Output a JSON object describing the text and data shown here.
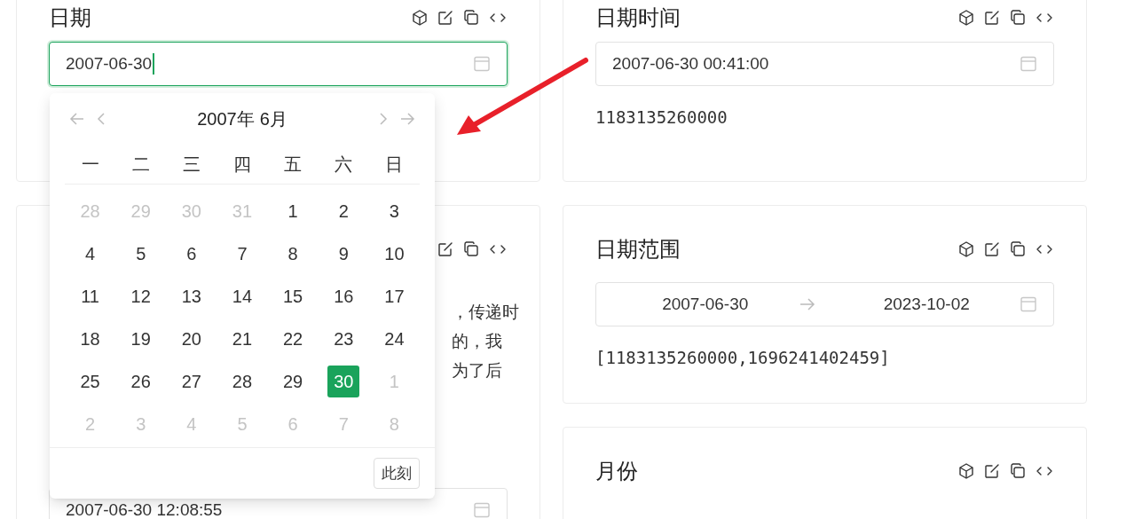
{
  "left_column": [
    {
      "kind": "single",
      "title": "日期",
      "field": {
        "value": "2007-06-30",
        "focused": true
      }
    },
    {
      "kind": "covered",
      "paragraph_lines": [
        "，传递时",
        "的，我",
        "为了后"
      ],
      "field": {
        "value": "2007-06-30 12:08:55",
        "focused": false
      }
    }
  ],
  "right_column": [
    {
      "kind": "single",
      "title": "日期时间",
      "field": {
        "value": "2007-06-30 00:41:00",
        "focused": false
      },
      "output": "1183135260000"
    },
    {
      "kind": "range",
      "title": "日期范围",
      "range": {
        "start": "2007-06-30",
        "end": "2023-10-02"
      },
      "output": "[1183135260000,1696241402459]"
    },
    {
      "kind": "single",
      "title": "月份"
    }
  ],
  "date_picker": {
    "year": "2007年",
    "month": "6月",
    "weekdays": [
      "一",
      "二",
      "三",
      "四",
      "五",
      "六",
      "日"
    ],
    "weeks": [
      [
        {
          "day": "28",
          "in_month": false,
          "selected": false
        },
        {
          "day": "29",
          "in_month": false,
          "selected": false
        },
        {
          "day": "30",
          "in_month": false,
          "selected": false
        },
        {
          "day": "31",
          "in_month": false,
          "selected": false
        },
        {
          "day": "1",
          "in_month": true,
          "selected": false
        },
        {
          "day": "2",
          "in_month": true,
          "selected": false
        },
        {
          "day": "3",
          "in_month": true,
          "selected": false
        }
      ],
      [
        {
          "day": "4",
          "in_month": true,
          "selected": false
        },
        {
          "day": "5",
          "in_month": true,
          "selected": false
        },
        {
          "day": "6",
          "in_month": true,
          "selected": false
        },
        {
          "day": "7",
          "in_month": true,
          "selected": false
        },
        {
          "day": "8",
          "in_month": true,
          "selected": false
        },
        {
          "day": "9",
          "in_month": true,
          "selected": false
        },
        {
          "day": "10",
          "in_month": true,
          "selected": false
        }
      ],
      [
        {
          "day": "11",
          "in_month": true,
          "selected": false
        },
        {
          "day": "12",
          "in_month": true,
          "selected": false
        },
        {
          "day": "13",
          "in_month": true,
          "selected": false
        },
        {
          "day": "14",
          "in_month": true,
          "selected": false
        },
        {
          "day": "15",
          "in_month": true,
          "selected": false
        },
        {
          "day": "16",
          "in_month": true,
          "selected": false
        },
        {
          "day": "17",
          "in_month": true,
          "selected": false
        }
      ],
      [
        {
          "day": "18",
          "in_month": true,
          "selected": false
        },
        {
          "day": "19",
          "in_month": true,
          "selected": false
        },
        {
          "day": "20",
          "in_month": true,
          "selected": false
        },
        {
          "day": "21",
          "in_month": true,
          "selected": false
        },
        {
          "day": "22",
          "in_month": true,
          "selected": false
        },
        {
          "day": "23",
          "in_month": true,
          "selected": false
        },
        {
          "day": "24",
          "in_month": true,
          "selected": false
        }
      ],
      [
        {
          "day": "25",
          "in_month": true,
          "selected": false
        },
        {
          "day": "26",
          "in_month": true,
          "selected": false
        },
        {
          "day": "27",
          "in_month": true,
          "selected": false
        },
        {
          "day": "28",
          "in_month": true,
          "selected": false
        },
        {
          "day": "29",
          "in_month": true,
          "selected": false
        },
        {
          "day": "30",
          "in_month": true,
          "selected": true
        },
        {
          "day": "1",
          "in_month": false,
          "selected": false
        }
      ],
      [
        {
          "day": "2",
          "in_month": false,
          "selected": false
        },
        {
          "day": "3",
          "in_month": false,
          "selected": false
        },
        {
          "day": "4",
          "in_month": false,
          "selected": false
        },
        {
          "day": "5",
          "in_month": false,
          "selected": false
        },
        {
          "day": "6",
          "in_month": false,
          "selected": false
        },
        {
          "day": "7",
          "in_month": false,
          "selected": false
        },
        {
          "day": "8",
          "in_month": false,
          "selected": false
        }
      ]
    ],
    "now_button": "此刻"
  }
}
